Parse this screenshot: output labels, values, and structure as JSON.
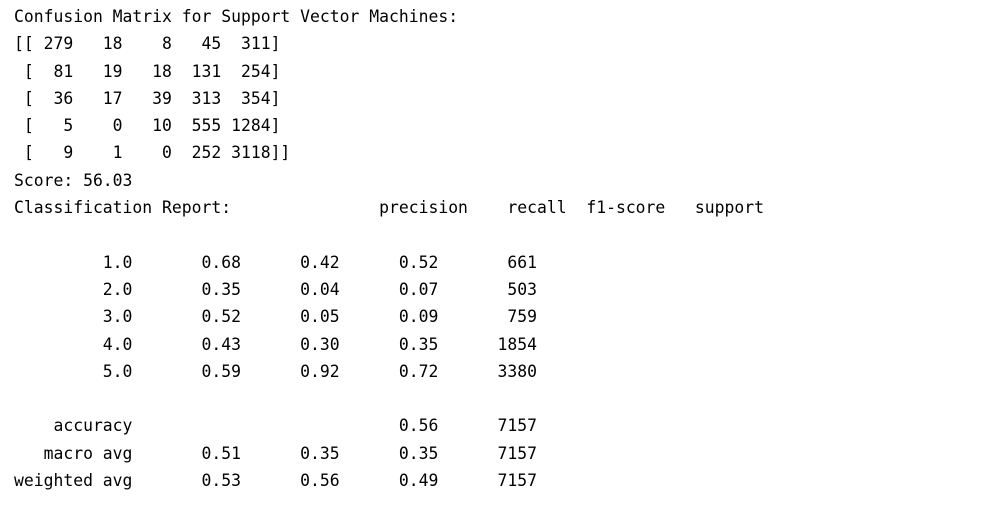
{
  "output": {
    "lines": [
      "Confusion Matrix for Support Vector Machines:",
      "[[ 279   18    8   45  311]",
      " [  81   19   18  131  254]",
      " [  36   17   39  313  354]",
      " [   5    0   10  555 1284]",
      " [   9    1    0  252 3118]]",
      "Score: 56.03",
      "Classification Report:               precision    recall  f1-score   support",
      "",
      "         1.0       0.68      0.42      0.52       661",
      "         2.0       0.35      0.04      0.07       503",
      "         3.0       0.52      0.05      0.09       759",
      "         4.0       0.43      0.30      0.35      1854",
      "         5.0       0.59      0.92      0.72      3380",
      "",
      "    accuracy                           0.56      7157",
      "   macro avg       0.51      0.35      0.35      7157",
      "weighted avg       0.53      0.56      0.49      7157"
    ]
  }
}
